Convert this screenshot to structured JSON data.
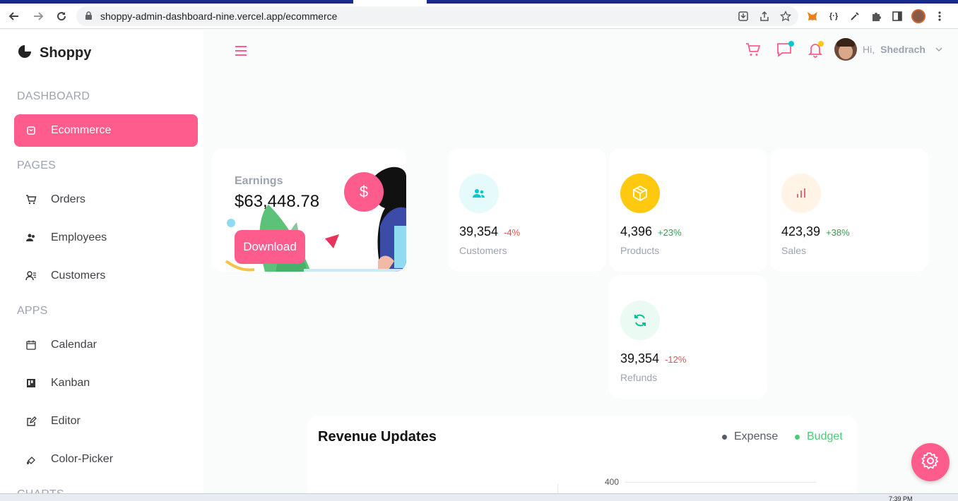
{
  "browser": {
    "url": "shoppy-admin-dashboard-nine.vercel.app/ecommerce"
  },
  "sidebar": {
    "brand": "Shoppy",
    "sections": [
      {
        "title": "DASHBOARD"
      },
      {
        "title": "PAGES"
      },
      {
        "title": "APPS"
      },
      {
        "title": "CHARTS"
      }
    ],
    "items": [
      {
        "label": "Ecommerce",
        "icon": "shopping-bag-icon",
        "active": true
      },
      {
        "label": "Orders",
        "icon": "cart-icon"
      },
      {
        "label": "Employees",
        "icon": "employees-icon"
      },
      {
        "label": "Customers",
        "icon": "customers-icon"
      },
      {
        "label": "Calendar",
        "icon": "calendar-icon"
      },
      {
        "label": "Kanban",
        "icon": "kanban-icon"
      },
      {
        "label": "Editor",
        "icon": "editor-icon"
      },
      {
        "label": "Color-Picker",
        "icon": "color-picker-icon"
      }
    ]
  },
  "header": {
    "greeting": "Hi,",
    "username": "Shedrach"
  },
  "earnings": {
    "label": "Earnings",
    "value": "$63,448.78",
    "button": "Download",
    "symbol": "$"
  },
  "stats": [
    {
      "value": "39,354",
      "change": "-4%",
      "label": "Customers",
      "icon": "customers-icon",
      "change_color": "#e05252",
      "icon_bg": "#e5fafb",
      "icon_color": "#03c9d7"
    },
    {
      "value": "4,396",
      "change": "+23%",
      "label": "Products",
      "icon": "box-icon",
      "change_color": "#2e9e4f",
      "icon_bg": "#fec90f",
      "icon_color": "#ffffff"
    },
    {
      "value": "423,39",
      "change": "+38%",
      "label": "Sales",
      "icon": "bar-chart-icon",
      "change_color": "#2e9e4f",
      "icon_bg": "#fff4e5",
      "icon_color": "#e46a76"
    },
    {
      "value": "39,354",
      "change": "-12%",
      "label": "Refunds",
      "icon": "refresh-icon",
      "change_color": "#e05252",
      "icon_bg": "#ebfaf2",
      "icon_color": "#00c292"
    }
  ],
  "revenue": {
    "title": "Revenue Updates",
    "legend": [
      {
        "label": "Expense",
        "color": "#555c66"
      },
      {
        "label": "Budget",
        "color": "#4ccb76"
      }
    ],
    "y_tick": "400"
  },
  "taskbar": {
    "clock": "7:39 PM"
  },
  "colors": {
    "accent": "#ff5c8e"
  }
}
